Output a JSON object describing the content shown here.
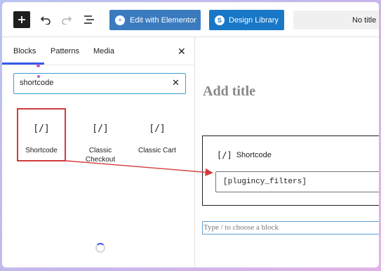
{
  "toolbar": {
    "elementor_label": "Edit with Elementor",
    "design_library_label": "Design Library",
    "title_text": "No title"
  },
  "inserter": {
    "tabs": [
      "Blocks",
      "Patterns",
      "Media"
    ],
    "active_tab": "Blocks",
    "search_value": "shortcode",
    "blocks": [
      {
        "glyph": "[/]",
        "label": "Shortcode"
      },
      {
        "glyph": "[/]",
        "label": "Classic Checkout"
      },
      {
        "glyph": "[/]",
        "label": "Classic Cart"
      }
    ]
  },
  "editor": {
    "title_placeholder": "Add title",
    "shortcode_block_title": "Shortcode",
    "shortcode_glyph": "[/]",
    "shortcode_value": "[plugincy_filters]",
    "appender_placeholder": "Type / to choose a block"
  },
  "colors": {
    "elementor_button": "#3a7bbf",
    "design_library_button": "#1977c7",
    "annotation_red": "#d23b3b",
    "focus_blue": "#3aa0d8"
  },
  "icons": {
    "add": "plus-icon",
    "undo": "undo-icon",
    "redo": "redo-icon",
    "list_view": "list-view-icon",
    "close": "close-icon",
    "clear": "clear-icon"
  }
}
